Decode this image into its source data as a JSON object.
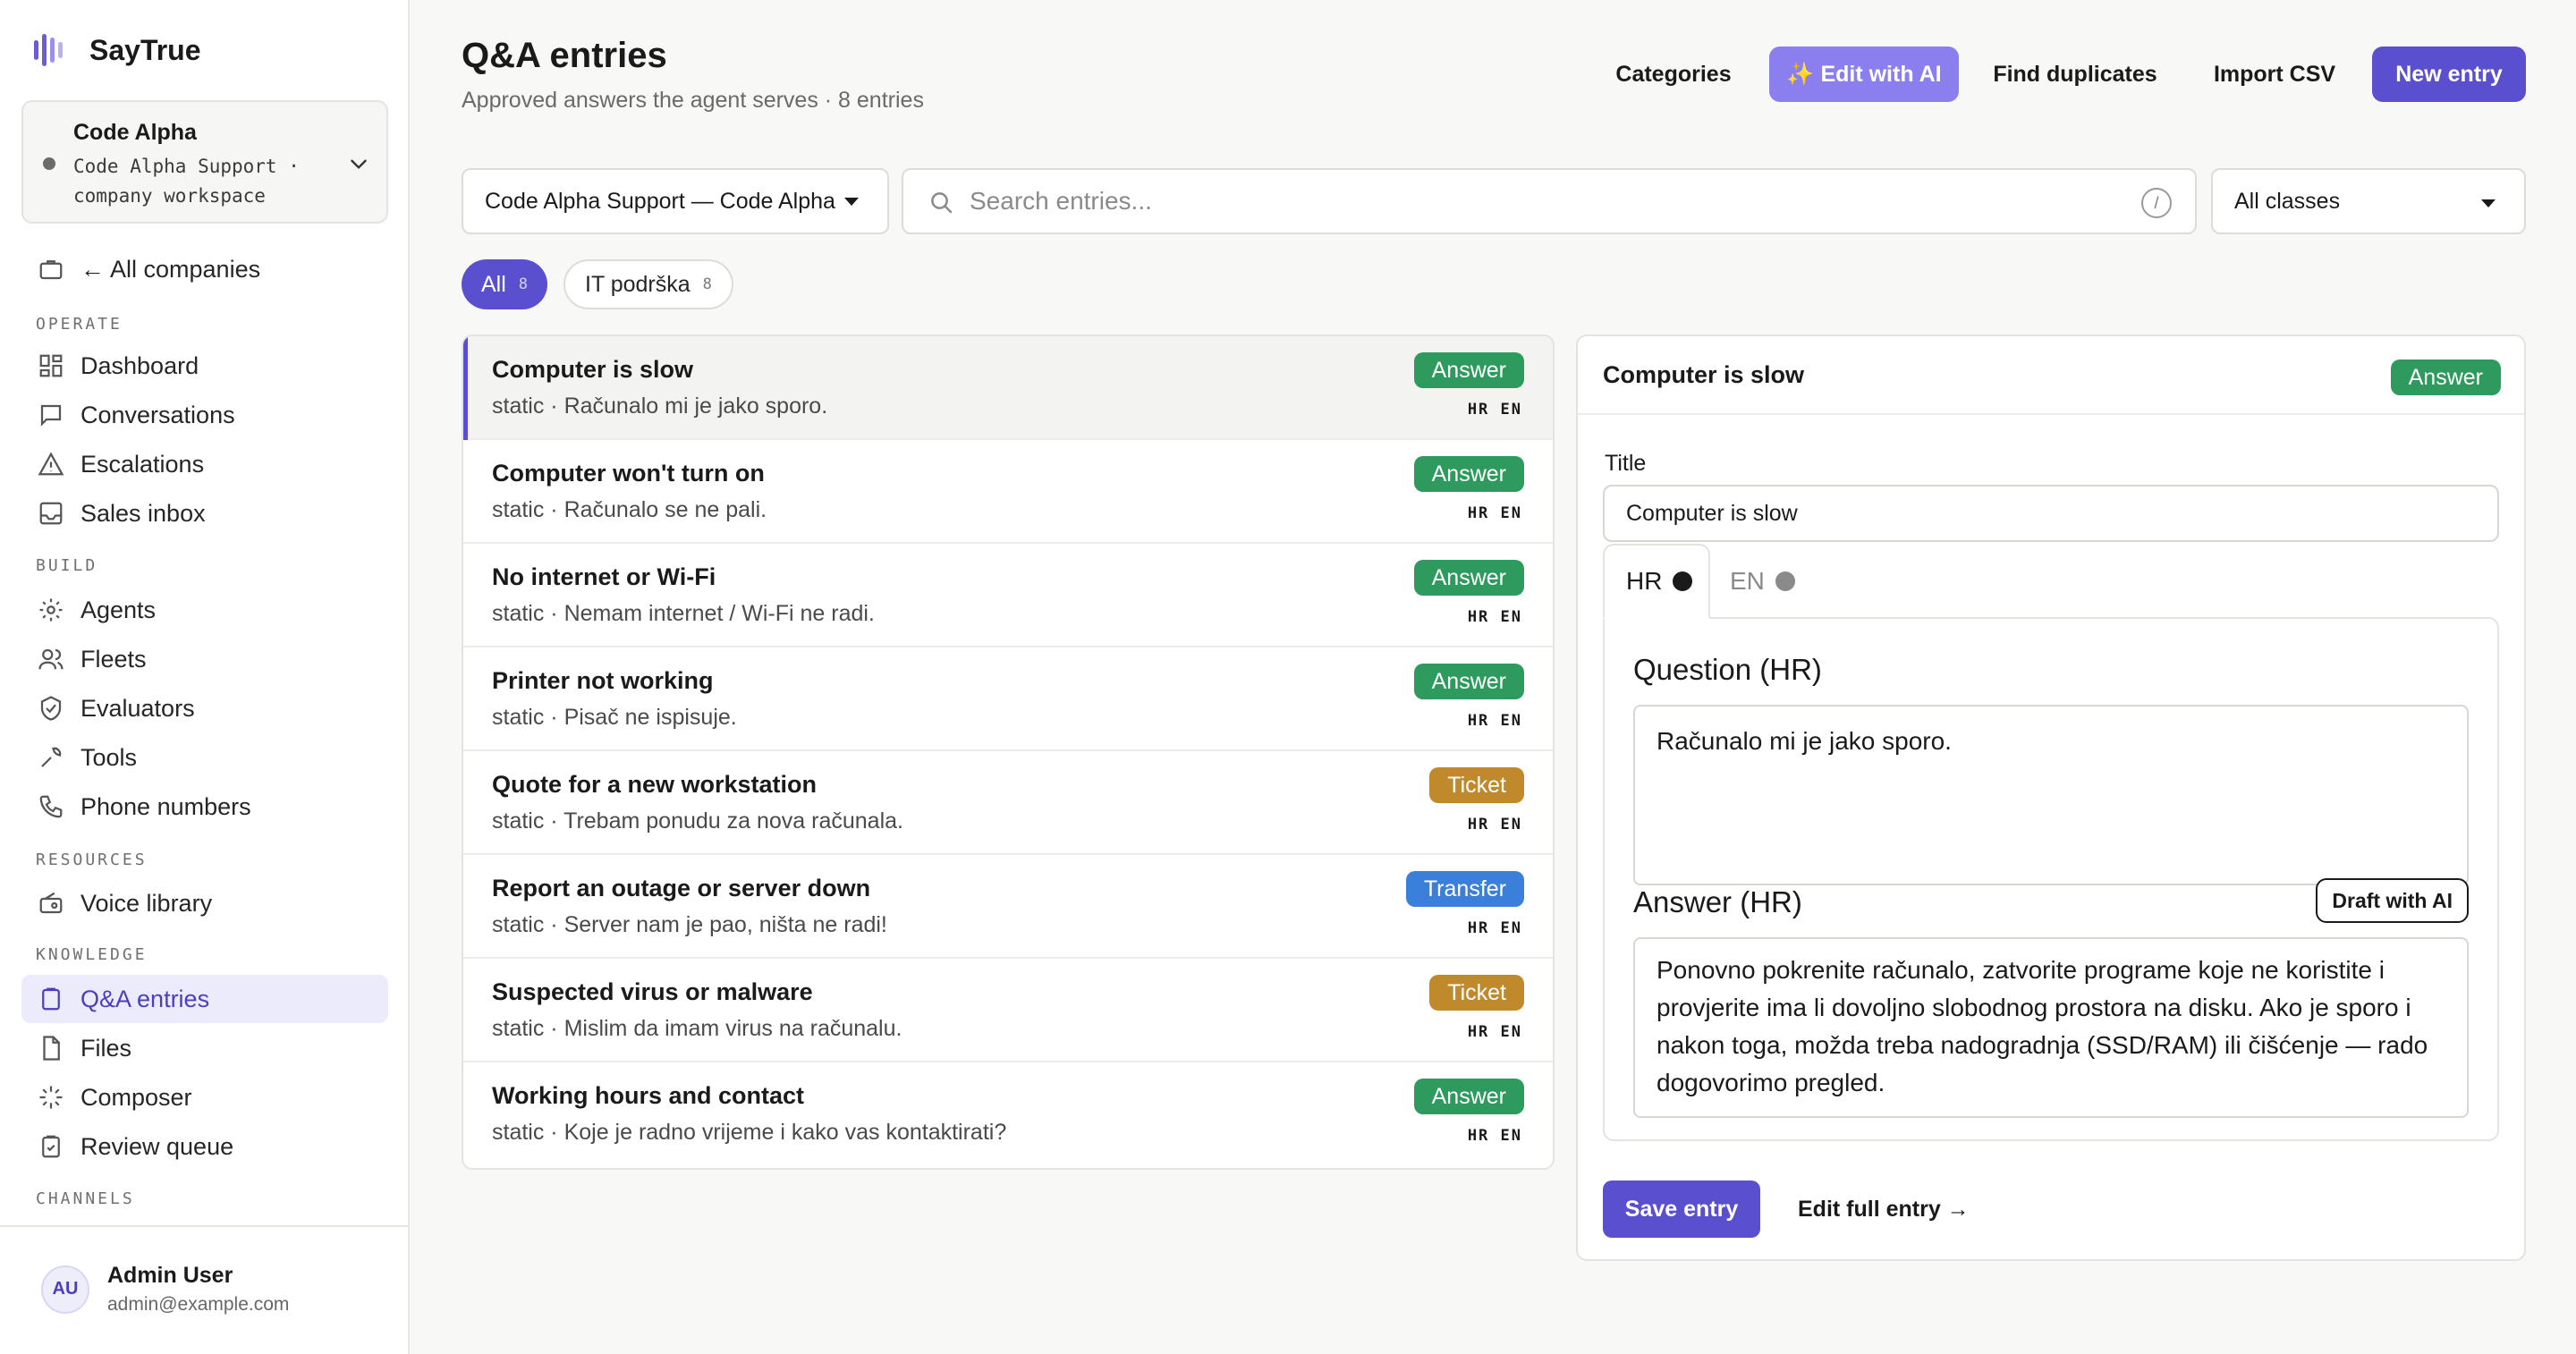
{
  "brand": {
    "name": "SayTrue"
  },
  "workspace": {
    "name": "Code Alpha",
    "detail": "Code Alpha Support · company workspace"
  },
  "sidebar": {
    "back": "← All companies",
    "sections": {
      "operate": "OPERATE",
      "build": "BUILD",
      "resources": "RESOURCES",
      "knowledge": "KNOWLEDGE",
      "channels": "CHANNELS"
    },
    "items": {
      "dashboard": "Dashboard",
      "conversations": "Conversations",
      "escalations": "Escalations",
      "sales_inbox": "Sales inbox",
      "agents": "Agents",
      "fleets": "Fleets",
      "evaluators": "Evaluators",
      "tools": "Tools",
      "phone_numbers": "Phone numbers",
      "voice_library": "Voice library",
      "qa_entries": "Q&A entries",
      "files": "Files",
      "composer": "Composer",
      "review_queue": "Review queue"
    },
    "active": "qa_entries"
  },
  "user": {
    "initials": "AU",
    "name": "Admin User",
    "email": "admin@example.com"
  },
  "header": {
    "title": "Q&A entries",
    "subtitle": "Approved answers the agent serves · 8 entries",
    "buttons": {
      "categories": "Categories",
      "edit_ai": "✨ Edit with AI",
      "find_duplicates": "Find duplicates",
      "import_csv": "Import CSV",
      "new_entry": "New entry"
    }
  },
  "filters": {
    "company": "Code Alpha Support — Code Alpha",
    "search_placeholder": "Search entries...",
    "search_shortcut": "/",
    "class": "All classes",
    "chips": [
      {
        "label": "All",
        "count": "8"
      },
      {
        "label": "IT podrška",
        "count": "8"
      }
    ]
  },
  "entries": [
    {
      "title": "Computer is slow",
      "sub": "static · Računalo mi je jako sporo.",
      "badge": "Answer",
      "langs": "HR EN"
    },
    {
      "title": "Computer won't turn on",
      "sub": "static · Računalo se ne pali.",
      "badge": "Answer",
      "langs": "HR EN"
    },
    {
      "title": "No internet or Wi-Fi",
      "sub": "static · Nemam internet / Wi-Fi ne radi.",
      "badge": "Answer",
      "langs": "HR EN"
    },
    {
      "title": "Printer not working",
      "sub": "static · Pisač ne ispisuje.",
      "badge": "Answer",
      "langs": "HR EN"
    },
    {
      "title": "Quote for a new workstation",
      "sub": "static · Trebam ponudu za nova računala.",
      "badge": "Ticket",
      "langs": "HR EN"
    },
    {
      "title": "Report an outage or server down",
      "sub": "static · Server nam je pao, ništa ne radi!",
      "badge": "Transfer",
      "langs": "HR EN"
    },
    {
      "title": "Suspected virus or malware",
      "sub": "static · Mislim da imam virus na računalu.",
      "badge": "Ticket",
      "langs": "HR EN"
    },
    {
      "title": "Working hours and contact",
      "sub": "static · Koje je radno vrijeme i kako vas kontaktirati?",
      "badge": "Answer",
      "langs": "HR EN"
    }
  ],
  "detail": {
    "title": "Computer is slow",
    "badge": "Answer",
    "title_label": "Title",
    "title_value": "Computer is slow",
    "tabs": {
      "hr": "HR",
      "en": "EN"
    },
    "question_label": "Question (HR)",
    "question_value": "Računalo mi je jako sporo.",
    "answer_label": "Answer (HR)",
    "answer_value": "Ponovno pokrenite računalo, zatvorite programe koje ne koristite i provjerite ima li dovoljno slobodnog prostora na disku. Ako je sporo i nakon toga, možda treba nadogradnja (SSD/RAM) ili čišćenje — rado dogovorimo pregled.",
    "draft_ai": "Draft with AI",
    "save": "Save entry",
    "edit_full": "Edit full entry →"
  },
  "colors": {
    "accent": "#5a4fcf",
    "ai": "#8b7ff0",
    "answer": "#2e9a5e",
    "ticket": "#c08a2c",
    "transfer": "#3a7fd9"
  }
}
